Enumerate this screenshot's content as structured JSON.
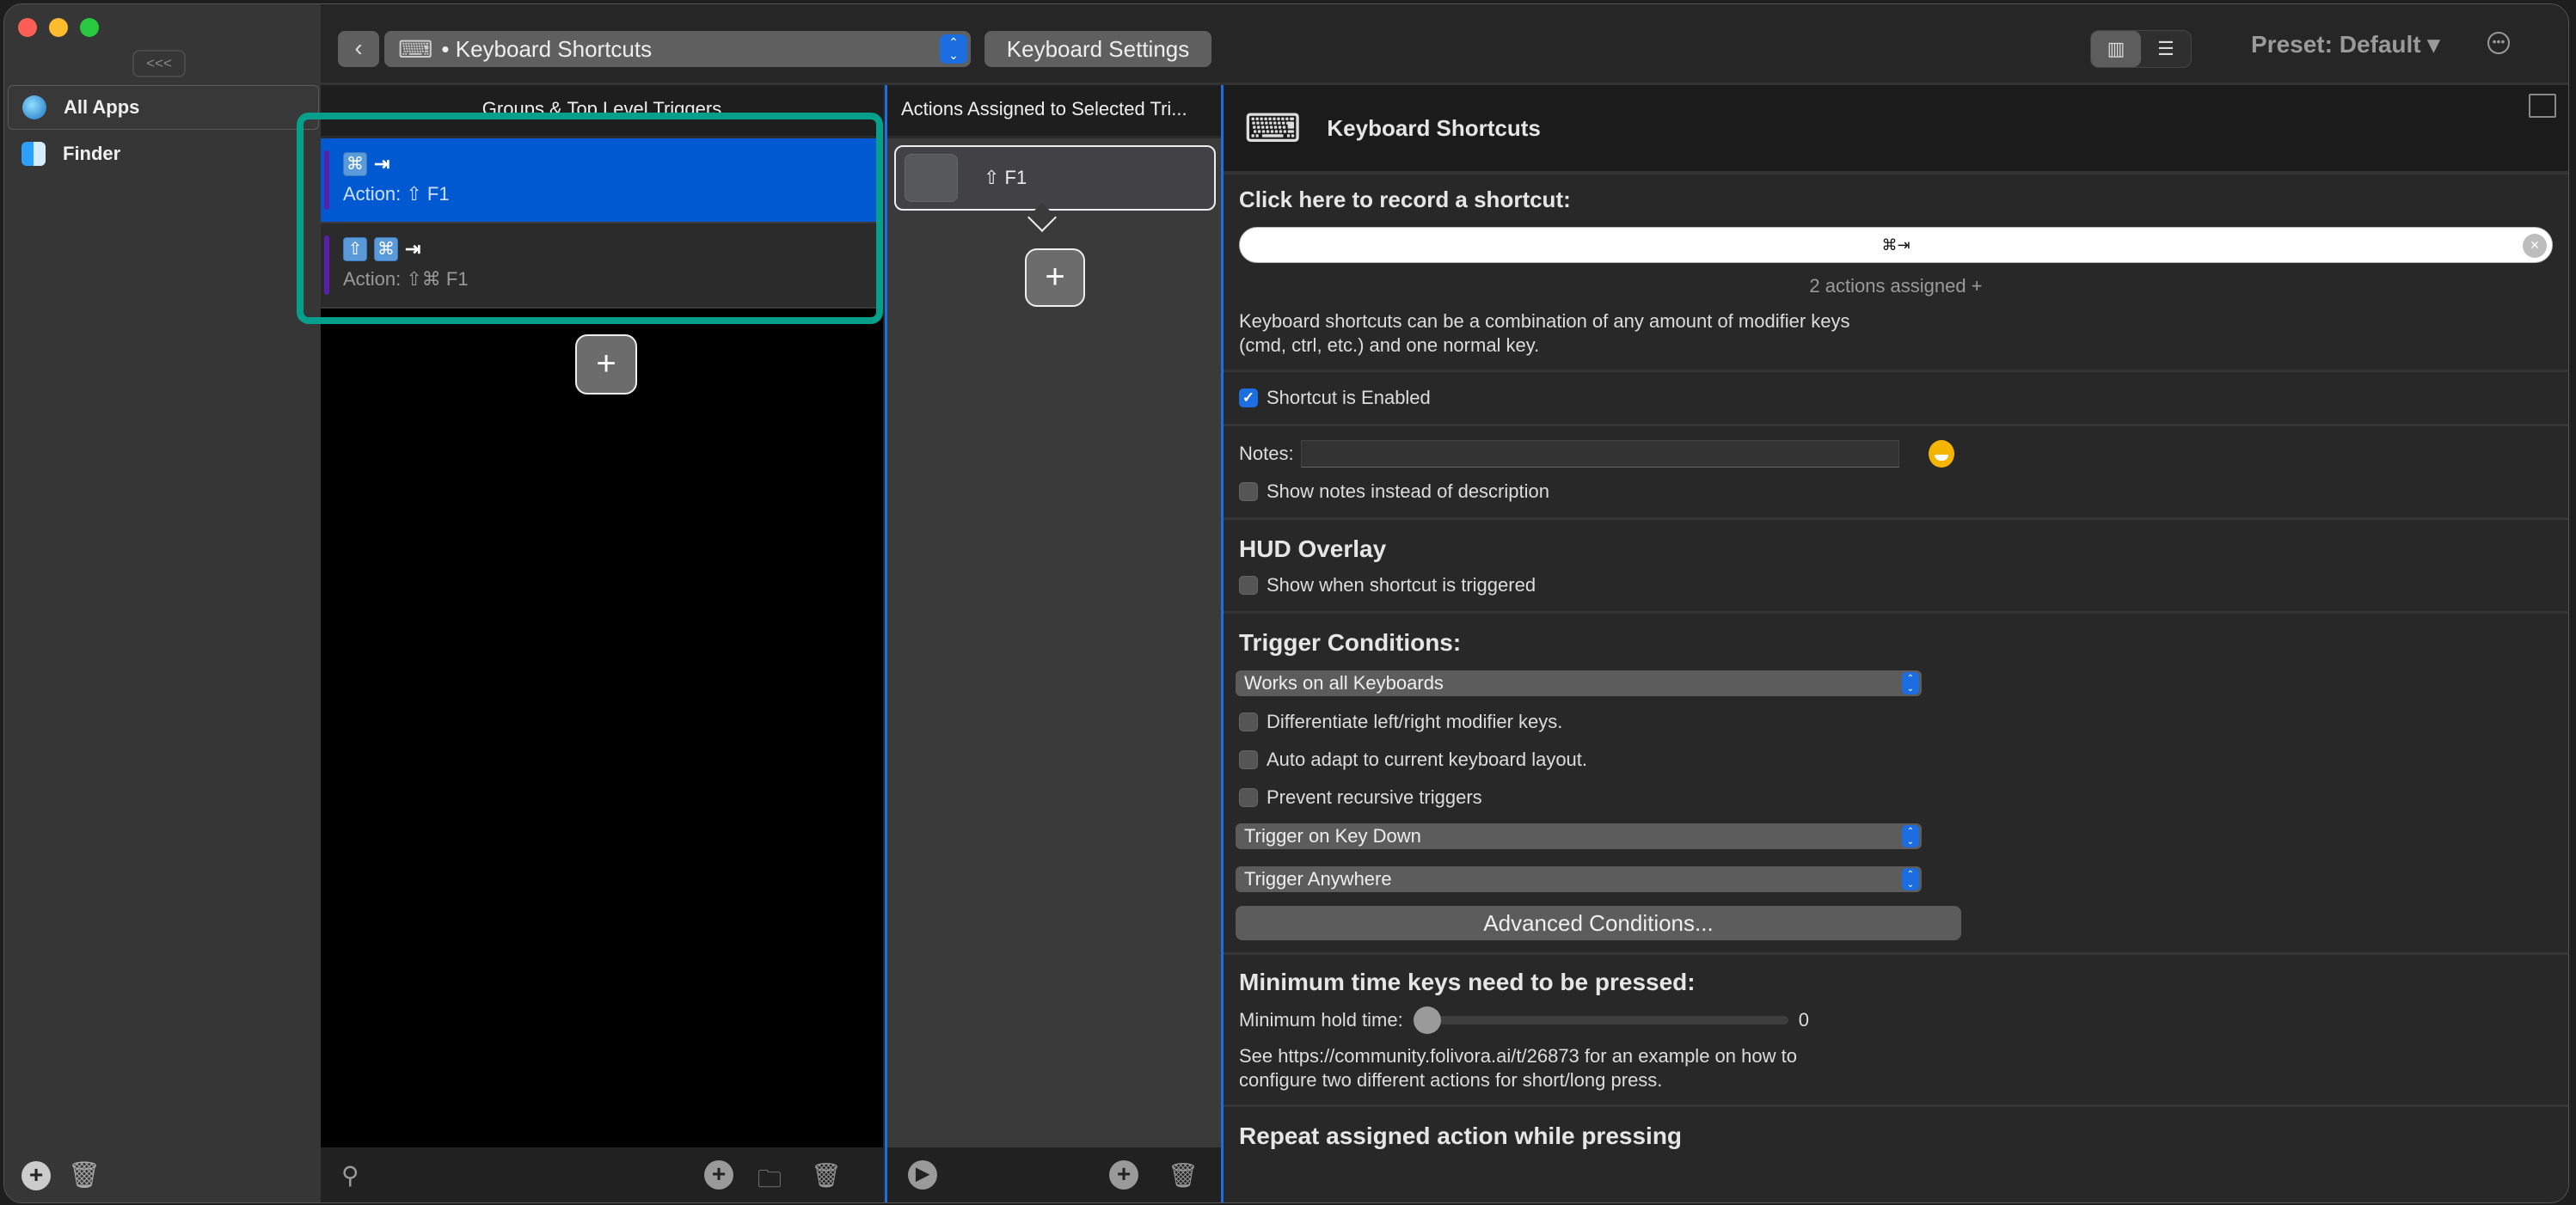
{
  "window": {
    "traffic_lights": {
      "close": "#ff5f57",
      "minimize": "#febc2e",
      "zoom": "#28c840"
    }
  },
  "sidebar": {
    "collapse_label": "<<<",
    "items": [
      {
        "label": "All Apps",
        "icon": "globe-icon",
        "selected": true
      },
      {
        "label": "Finder",
        "icon": "finder-icon",
        "selected": false
      }
    ]
  },
  "toolbar": {
    "back_icon": "chevron-left-icon",
    "trigger_type": "• Keyboard Shortcuts",
    "settings_label": "Keyboard Settings",
    "preset_label": "Preset: Default ▾",
    "more_icon": "ellipsis-circle-icon",
    "view_modes": [
      "columns",
      "list"
    ],
    "active_view": "columns"
  },
  "triggers": {
    "header": "Groups & Top Level Triggers",
    "rows": [
      {
        "keys": [
          "⌘"
        ],
        "key": "⇥",
        "action": "Action: ⇧ F1",
        "selected": true
      },
      {
        "keys": [
          "⇧",
          "⌘"
        ],
        "key": "⇥",
        "action": "Action: ⇧⌘ F1",
        "selected": false
      }
    ],
    "add_label": "+"
  },
  "actions": {
    "header": "Actions Assigned to Selected Tri...",
    "items": [
      {
        "label": "⇧ F1"
      }
    ],
    "add_label": "+"
  },
  "detail": {
    "title": "Keyboard Shortcuts",
    "record_heading": "Click here to record a shortcut:",
    "recorded_shortcut": "⌘⇥",
    "assigned_count": "2 actions assigned +",
    "description": "Keyboard shortcuts can be a combination of any amount of modifier keys",
    "description2": "(cmd, ctrl, etc.) and one normal key.",
    "enabled_label": "Shortcut is Enabled",
    "enabled": true,
    "notes_label": "Notes:",
    "notes_value": "",
    "show_notes_label": "Show notes instead of description",
    "hud_heading": "HUD Overlay",
    "hud_label": "Show when shortcut is triggered",
    "conditions_heading": "Trigger Conditions:",
    "keyboard_select": "Works on all Keyboards",
    "differentiate_label": "Differentiate left/right modifier keys.",
    "auto_adapt_label": "Auto adapt to current keyboard layout.",
    "prevent_label": "Prevent recursive triggers",
    "key_event_select": "Trigger on Key Down",
    "location_select": "Trigger Anywhere",
    "advanced_label": "Advanced Conditions...",
    "min_time_heading": "Minimum time keys need to be pressed:",
    "hold_label": "Minimum hold time:",
    "hold_value": "0",
    "hold_fraction": 0,
    "hint1": "See https://community.folivora.ai/t/26873 for an example on how to",
    "hint2": "configure two different actions for short/long press.",
    "repeat_heading": "Repeat assigned action while pressing"
  },
  "colors": {
    "accent": "#1d6ee0",
    "selection": "#0059d0",
    "highlight_frame": "#04a08c",
    "group_bar": "#5a1fa8"
  }
}
